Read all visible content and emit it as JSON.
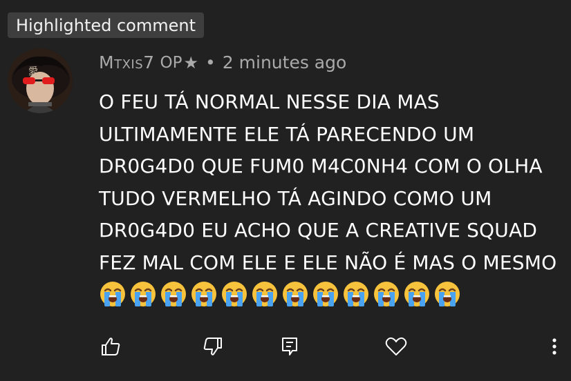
{
  "badge": {
    "label": "Highlighted comment"
  },
  "comment": {
    "author": "Mtxis7",
    "op_label": "OP",
    "op_star": "★",
    "separator": "•",
    "time": "2 minutes ago",
    "text": "O FEU TÁ NORMAL NESSE DIA MAS ULTIMAMENTE ELE TÁ PARECENDO UM DR0G4D0 QUE FUM0 M4C0NH4 COM O OLHA TUDO VERMELHO TÁ AGINDO COMO UM DR0G4D0 EU ACHO QUE A CREATIVE SQUAD FEZ MAL COM ELE E ELE NÃO É MAS O MESMO",
    "emoji_count": 12,
    "emoji_name": "loudly-crying-face"
  },
  "actions": {
    "like": "thumbs-up-icon",
    "dislike": "thumbs-down-icon",
    "reply": "reply-icon",
    "heart": "heart-icon",
    "more": "more-vertical-icon"
  },
  "colors": {
    "background": "#212121",
    "badge_bg": "#3e3e3e",
    "meta_text": "#aaaaaa",
    "body_text": "#ffffff"
  }
}
